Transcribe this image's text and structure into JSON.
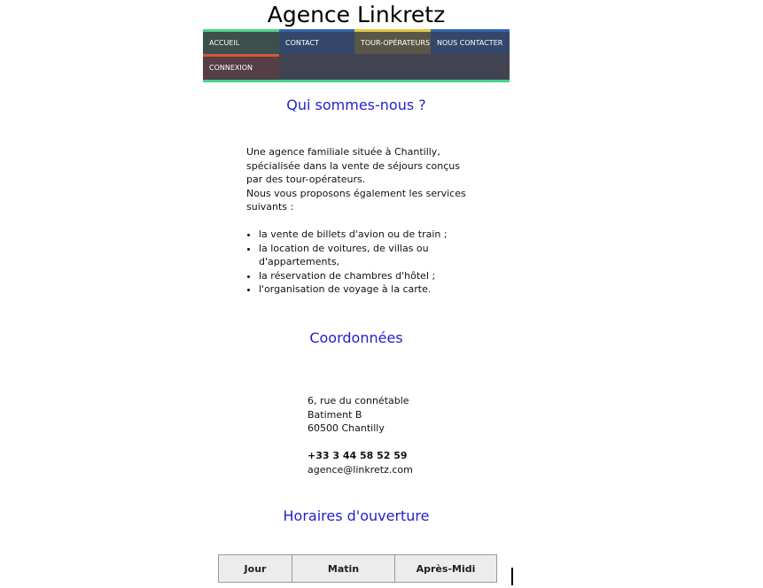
{
  "site": {
    "title": "Agence Linkretz"
  },
  "nav": {
    "items": [
      {
        "label": "Accueil",
        "color": "#3c4f4a",
        "accent": "#4ad38a"
      },
      {
        "label": "Contact",
        "color": "#34476a",
        "accent": "#2d66b0"
      },
      {
        "label": "Tour-opérateurs",
        "color": "#5a5647",
        "accent": "#e0c640"
      },
      {
        "label": "Nous contacter",
        "color": "#34476a",
        "accent": "#2d66b0"
      },
      {
        "label": "Connexion",
        "color": "#553e44",
        "accent": "#d5573b"
      }
    ],
    "bar_color": "#414350",
    "bottom_accent": "#4ad38a"
  },
  "about": {
    "heading": "Qui sommes-nous ?",
    "paragraph_1": "Une agence familiale située à Chantilly, spécialisée dans la vente de séjours conçus par des tour-opérateurs.",
    "paragraph_2": "Nous vous proposons également les services suivants :",
    "services": [
      "la vente de billets d'avion ou de train ;",
      "la location de voitures, de villas ou d'appartements,",
      "la réservation de chambres d'hôtel ;",
      "l'organisation de voyage à la carte."
    ]
  },
  "contact": {
    "heading": "Coordonnées",
    "address_line_1": "6, rue du connétable",
    "address_line_2": "Batiment B",
    "address_line_3": "60500 Chantilly",
    "phone": "+33 3 44 58 52 59",
    "email": "agence@linkretz.com"
  },
  "hours": {
    "heading": "Horaires d'ouverture",
    "columns": [
      "Jour",
      "Matin",
      "Après-Midi"
    ]
  },
  "colors": {
    "heading": "#2222cc"
  }
}
